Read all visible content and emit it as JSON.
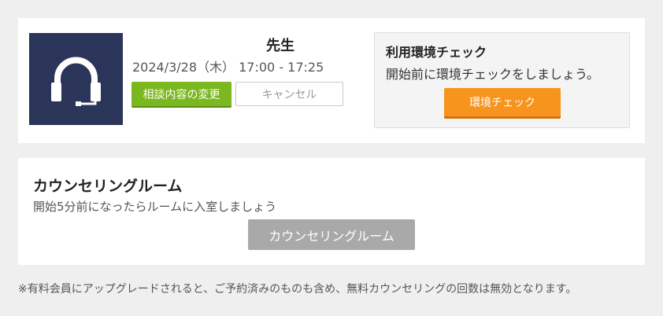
{
  "session": {
    "teacher_name": "先生",
    "datetime": "2024/3/28（木） 17:00 - 17:25",
    "change_label": "相談内容の変更",
    "cancel_label": "キャンセル",
    "avatar_icon": "headset-icon"
  },
  "env_check": {
    "title": "利用環境チェック",
    "description": "開始前に環境チェックをしましょう。",
    "button_label": "環境チェック"
  },
  "room": {
    "title": "カウンセリングルーム",
    "description": "開始5分前になったらルームに入室しましょう",
    "button_label": "カウンセリングルーム"
  },
  "notice": "※有料会員にアップグレードされると、ご予約済みのものも含め、無料カウンセリングの回数は無効となります。",
  "colors": {
    "background": "#efefef",
    "avatar_bg": "#2b3559",
    "change_button": "#7bb81f",
    "env_button": "#f7941d",
    "room_button_disabled": "#a9a9a9"
  }
}
